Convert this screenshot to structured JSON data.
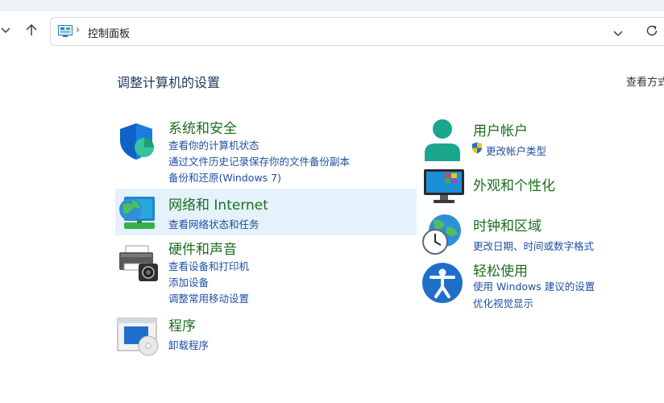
{
  "address_bar": {
    "path": "控制面板"
  },
  "page": {
    "title": "调整计算机的设置",
    "view_by": "查看方式"
  },
  "categories": {
    "system_security": {
      "title": "系统和安全",
      "links": [
        "查看你的计算机状态",
        "通过文件历史记录保存你的文件备份副本",
        "备份和还原(Windows 7)"
      ]
    },
    "network": {
      "title": "网络和 Internet",
      "links": [
        "查看网络状态和任务"
      ]
    },
    "hardware": {
      "title": "硬件和声音",
      "links": [
        "查看设备和打印机",
        "添加设备",
        "调整常用移动设置"
      ]
    },
    "programs": {
      "title": "程序",
      "links": [
        "卸载程序"
      ]
    },
    "user_accounts": {
      "title": "用户帐户",
      "links": [
        "更改帐户类型"
      ]
    },
    "appearance": {
      "title": "外观和个性化"
    },
    "clock_region": {
      "title": "时钟和区域",
      "links": [
        "更改日期、时间或数字格式"
      ]
    },
    "ease_of_access": {
      "title": "轻松使用",
      "links": [
        "使用 Windows 建议的设置",
        "优化视觉显示"
      ]
    }
  },
  "colors": {
    "category_title": "#1b6e1f",
    "link": "#1f4fa3",
    "hover_bg": "#e5f1fb"
  }
}
